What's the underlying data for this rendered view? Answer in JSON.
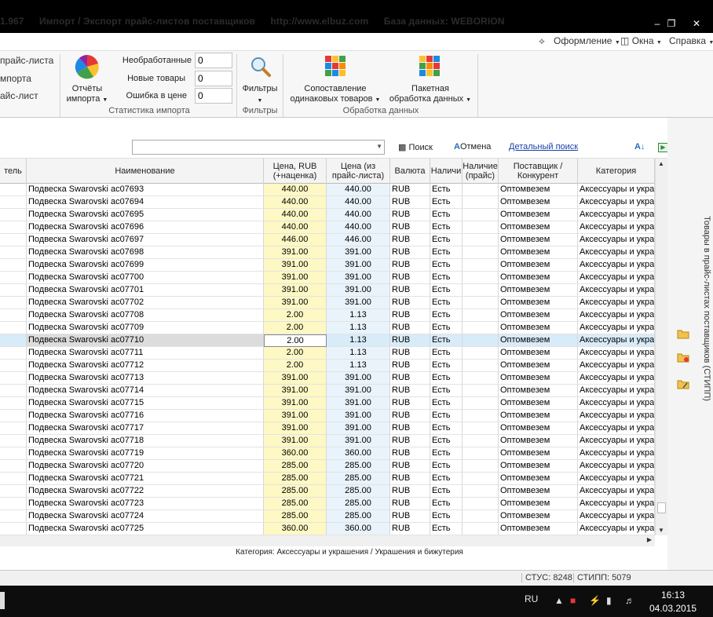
{
  "window": {
    "title_parts": [
      "1.967",
      "Импорт / Экспорт прайс-листов поставщиков",
      "http://www.elbuz.com",
      "База данных: WEBORION"
    ]
  },
  "menu": {
    "appearance": "Оформление",
    "windows": "Окна",
    "help": "Справка"
  },
  "ribbon": {
    "left_links": [
      "прайс-листа",
      "мпорта",
      "айс-лист"
    ],
    "reports_label_1": "Отчёты",
    "reports_label_2": "импорта",
    "stats": {
      "unprocessed_label": "Необработанные",
      "unprocessed_value": "0",
      "new_goods_label": "Новые товары",
      "new_goods_value": "0",
      "price_error_label": "Ошибка в цене",
      "price_error_value": "0",
      "group_label": "Статистика импорта"
    },
    "filters_label": "Фильтры",
    "filters_group_label": "Фильтры",
    "compare_label_1": "Сопоставление",
    "compare_label_2": "одинаковых товаров",
    "batch_label_1": "Пакетная",
    "batch_label_2": "обработка данных",
    "processing_group_label": "Обработка данных"
  },
  "toolbar": {
    "search_value": "",
    "search_btn": "Поиск",
    "cancel_btn": "Отмена",
    "advanced_search": "Детальный поиск"
  },
  "grid": {
    "columns": [
      {
        "key": "maker",
        "label": "тель",
        "w": 34
      },
      {
        "key": "name",
        "label": "Наименование",
        "w": 302
      },
      {
        "key": "price",
        "label": "Цена, RUB (+наценка)",
        "w": 80
      },
      {
        "key": "price_src",
        "label": "Цена (из прайс-листа)",
        "w": 81
      },
      {
        "key": "currency",
        "label": "Валюта",
        "w": 51
      },
      {
        "key": "avail",
        "label": "Наличи",
        "w": 41
      },
      {
        "key": "avail_src",
        "label": "Наличие (прайс)",
        "w": 46
      },
      {
        "key": "supplier",
        "label": "Поставщик / Конкурент",
        "w": 101
      },
      {
        "key": "category",
        "label": "Категория",
        "w": 98
      }
    ],
    "selected_index": 12,
    "rows": [
      [
        "Подвеска Swarovski ac07693",
        "440.00",
        "440.00",
        "RUB",
        "Есть",
        "",
        "Оптомвезем",
        "Аксессуары и укра"
      ],
      [
        "Подвеска Swarovski ac07694",
        "440.00",
        "440.00",
        "RUB",
        "Есть",
        "",
        "Оптомвезем",
        "Аксессуары и укра"
      ],
      [
        "Подвеска Swarovski ac07695",
        "440.00",
        "440.00",
        "RUB",
        "Есть",
        "",
        "Оптомвезем",
        "Аксессуары и укра"
      ],
      [
        "Подвеска Swarovski ac07696",
        "440.00",
        "440.00",
        "RUB",
        "Есть",
        "",
        "Оптомвезем",
        "Аксессуары и укра"
      ],
      [
        "Подвеска Swarovski ac07697",
        "446.00",
        "446.00",
        "RUB",
        "Есть",
        "",
        "Оптомвезем",
        "Аксессуары и укра"
      ],
      [
        "Подвеска Swarovski ac07698",
        "391.00",
        "391.00",
        "RUB",
        "Есть",
        "",
        "Оптомвезем",
        "Аксессуары и укра"
      ],
      [
        "Подвеска Swarovski ac07699",
        "391.00",
        "391.00",
        "RUB",
        "Есть",
        "",
        "Оптомвезем",
        "Аксессуары и укра"
      ],
      [
        "Подвеска Swarovski ac07700",
        "391.00",
        "391.00",
        "RUB",
        "Есть",
        "",
        "Оптомвезем",
        "Аксессуары и укра"
      ],
      [
        "Подвеска Swarovski ac07701",
        "391.00",
        "391.00",
        "RUB",
        "Есть",
        "",
        "Оптомвезем",
        "Аксессуары и укра"
      ],
      [
        "Подвеска Swarovski ac07702",
        "391.00",
        "391.00",
        "RUB",
        "Есть",
        "",
        "Оптомвезем",
        "Аксессуары и укра"
      ],
      [
        "Подвеска Swarovski ac07708",
        "2.00",
        "1.13",
        "RUB",
        "Есть",
        "",
        "Оптомвезем",
        "Аксессуары и укра"
      ],
      [
        "Подвеска Swarovski ac07709",
        "2.00",
        "1.13",
        "RUB",
        "Есть",
        "",
        "Оптомвезем",
        "Аксессуары и укра"
      ],
      [
        "Подвеска Swarovski ac07710",
        "2.00",
        "1.13",
        "RUB",
        "Есть",
        "",
        "Оптомвезем",
        "Аксессуары и укра"
      ],
      [
        "Подвеска Swarovski ac07711",
        "2.00",
        "1.13",
        "RUB",
        "Есть",
        "",
        "Оптомвезем",
        "Аксессуары и укра"
      ],
      [
        "Подвеска Swarovski ac07712",
        "2.00",
        "1.13",
        "RUB",
        "Есть",
        "",
        "Оптомвезем",
        "Аксессуары и укра"
      ],
      [
        "Подвеска Swarovski ac07713",
        "391.00",
        "391.00",
        "RUB",
        "Есть",
        "",
        "Оптомвезем",
        "Аксессуары и укра"
      ],
      [
        "Подвеска Swarovski ac07714",
        "391.00",
        "391.00",
        "RUB",
        "Есть",
        "",
        "Оптомвезем",
        "Аксессуары и укра"
      ],
      [
        "Подвеска Swarovski ac07715",
        "391.00",
        "391.00",
        "RUB",
        "Есть",
        "",
        "Оптомвезем",
        "Аксессуары и укра"
      ],
      [
        "Подвеска Swarovski ac07716",
        "391.00",
        "391.00",
        "RUB",
        "Есть",
        "",
        "Оптомвезем",
        "Аксессуары и укра"
      ],
      [
        "Подвеска Swarovski ac07717",
        "391.00",
        "391.00",
        "RUB",
        "Есть",
        "",
        "Оптомвезем",
        "Аксессуары и укра"
      ],
      [
        "Подвеска Swarovski ac07718",
        "391.00",
        "391.00",
        "RUB",
        "Есть",
        "",
        "Оптомвезем",
        "Аксессуары и укра"
      ],
      [
        "Подвеска Swarovski ac07719",
        "360.00",
        "360.00",
        "RUB",
        "Есть",
        "",
        "Оптомвезем",
        "Аксессуары и укра"
      ],
      [
        "Подвеска Swarovski ac07720",
        "285.00",
        "285.00",
        "RUB",
        "Есть",
        "",
        "Оптомвезем",
        "Аксессуары и укра"
      ],
      [
        "Подвеска Swarovski ac07721",
        "285.00",
        "285.00",
        "RUB",
        "Есть",
        "",
        "Оптомвезем",
        "Аксессуары и укра"
      ],
      [
        "Подвеска Swarovski ac07722",
        "285.00",
        "285.00",
        "RUB",
        "Есть",
        "",
        "Оптомвезем",
        "Аксессуары и укра"
      ],
      [
        "Подвеска Swarovski ac07723",
        "285.00",
        "285.00",
        "RUB",
        "Есть",
        "",
        "Оптомвезем",
        "Аксессуары и укра"
      ],
      [
        "Подвеска Swarovski ac07724",
        "285.00",
        "285.00",
        "RUB",
        "Есть",
        "",
        "Оптомвезем",
        "Аксессуары и укра"
      ],
      [
        "Подвеска Swarovski ac07725",
        "360.00",
        "360.00",
        "RUB",
        "Есть",
        "",
        "Оптомвезем",
        "Аксессуары и укра"
      ]
    ]
  },
  "category_status": "Категория: Аксессуары и украшения / Украшения и бижутерия",
  "side_panel": {
    "title": "Товары в прайс-листах поставщиков (СТИПП)"
  },
  "statusbar": {
    "stus": "СТУС: 8248",
    "stipp": "СТИПП: 5079"
  },
  "taskbar": {
    "lang": "RU",
    "time": "16:13",
    "date": "04.03.2015"
  },
  "colors": {
    "price_cell": "#fdf8c4",
    "price_src_cell": "#e9f3fb",
    "selected_row": "#d8ebf9",
    "link": "#1a3fa8"
  }
}
